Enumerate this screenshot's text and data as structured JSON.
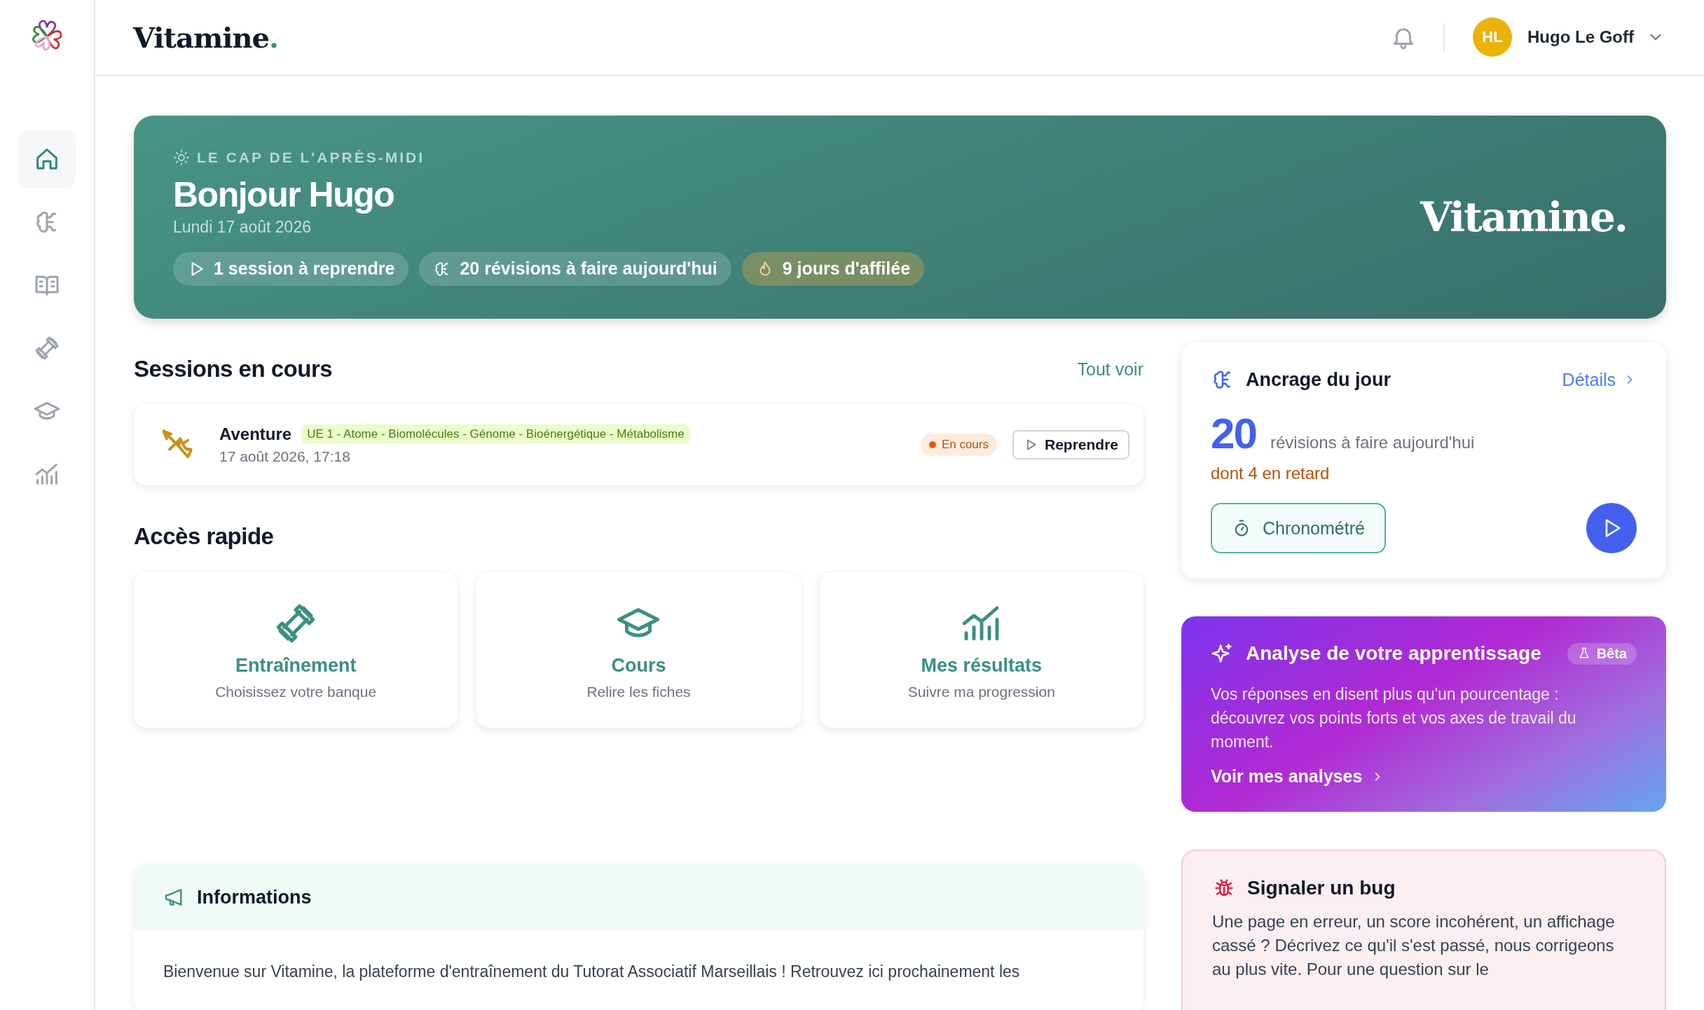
{
  "header": {
    "logo": "Vitamine.",
    "user": {
      "initials": "HL",
      "name": "Hugo Le Goff"
    }
  },
  "sidebar": {
    "items": [
      {
        "selected": true
      },
      {
        "selected": false
      },
      {
        "selected": false
      },
      {
        "selected": false
      },
      {
        "selected": false
      },
      {
        "selected": false
      }
    ]
  },
  "banner": {
    "eyebrow": "LE CAP DE L'APRÈS-MIDI",
    "title": "Bonjour Hugo",
    "date": "Lundi 17 août 2026",
    "logo": "Vitamine.",
    "chips": [
      {
        "kind": "session",
        "label": "1 session à reprendre"
      },
      {
        "kind": "revisions",
        "label": "20 révisions à faire aujourd'hui"
      },
      {
        "kind": "streak",
        "label": "9 jours d'affilée"
      }
    ]
  },
  "sessions": {
    "title": "Sessions en cours",
    "link": "Tout voir",
    "items": [
      {
        "name": "Aventure",
        "tag": "UE 1 - Atome - Biomolécules - Génome - Bioénergétique - Métabolisme",
        "date": "17 août 2026, 17:18",
        "status": "En cours",
        "action": "Reprendre"
      }
    ]
  },
  "quick_access": {
    "title": "Accès rapide",
    "items": [
      {
        "kind": "training",
        "title": "Entraînement",
        "subtitle": "Choisissez votre banque"
      },
      {
        "kind": "courses",
        "title": "Cours",
        "subtitle": "Relire les fiches"
      },
      {
        "kind": "results",
        "title": "Mes résultats",
        "subtitle": "Suivre ma progression"
      }
    ]
  },
  "informations": {
    "title": "Informations",
    "text": "Bienvenue sur Vitamine, la plateforme d'entraînement du Tutorat Associatif Marseillais ! Retrouvez ici prochainement les"
  },
  "anchor": {
    "title": "Ancrage du jour",
    "link": "Détails",
    "count": "20",
    "count_label": "révisions à faire aujourd'hui",
    "late": "dont 4 en retard",
    "mode_button": "Chronométré"
  },
  "analysis": {
    "title": "Analyse de votre apprentissage",
    "badge": "Bêta",
    "text": "Vos réponses en disent plus qu'un pourcentage : découvrez vos points forts et vos axes de travail du moment.",
    "link": "Voir mes analyses"
  },
  "bug_report": {
    "title": "Signaler un bug",
    "text": "Une page en erreur, un score incohérent, un affichage cassé ? Décrivez ce qu'il s'est passé, nous corrigeons au plus vite. Pour une question sur le"
  }
}
